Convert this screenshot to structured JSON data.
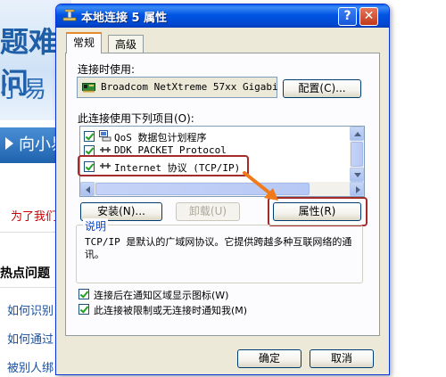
{
  "background": {
    "banner_line1": "题难问",
    "banner_line2": "小易",
    "button_label": "向小易",
    "red_text": "为了我们的",
    "section_heading": "热点问题",
    "links": [
      "如何识别",
      "如何通过",
      "被别人绑"
    ]
  },
  "dialog": {
    "title": "本地连接 5 属性",
    "help_button": "?",
    "close_button": "✕",
    "tabs": [
      {
        "label": "常规",
        "active": true
      },
      {
        "label": "高级",
        "active": false
      }
    ],
    "connect_using_label": "连接时使用:",
    "adapter_name": "Broadcom NetXtreme 57xx Gigabi",
    "configure_button": "配置(C)...",
    "items_label": "此连接使用下列项目(O):",
    "items": [
      {
        "label": "QoS 数据包计划程序",
        "checked": true,
        "icon": "qos-icon"
      },
      {
        "label": "DDK PACKET Protocol",
        "checked": true,
        "icon": "protocol-icon"
      },
      {
        "label": "Internet 协议 (TCP/IP)",
        "checked": true,
        "icon": "protocol-icon"
      }
    ],
    "install_button": "安装(N)...",
    "uninstall_button": "卸载(U)",
    "properties_button": "属性(R)",
    "description_title": "说明",
    "description_text": "TCP/IP 是默认的广域网协议。它提供跨越多种互联网络的通讯。",
    "show_icon_checkbox": "连接后在通知区域显示图标(W)",
    "notify_checkbox": "此连接被限制或无连接时通知我(M)",
    "ok_button": "确定",
    "cancel_button": "取消"
  },
  "colors": {
    "titlebar": "#0054e3",
    "dialog_bg": "#ece9d8",
    "highlight": "#a52a2a",
    "arrow": "#f07a1a",
    "link": "#1a4f9c",
    "red_text": "#cc0000"
  }
}
